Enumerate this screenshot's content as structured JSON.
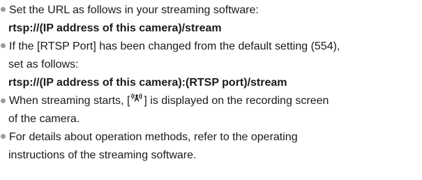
{
  "items": [
    {
      "text": "Set the URL as follows in your streaming software:",
      "url": "rtsp://(IP address of this camera)/stream"
    },
    {
      "text_line1": "If the [RTSP Port] has been changed from the default setting (554),",
      "text_line2": "set as follows:",
      "url": "rtsp://(IP address of this camera):(RTSP port)/stream"
    },
    {
      "text_before_icon": "When streaming starts, [",
      "icon": "streaming-broadcast-icon",
      "text_after_icon": "] is displayed on the recording screen",
      "text_line2": "of the camera."
    },
    {
      "text_line1": "For details about operation methods, refer to the operating",
      "text_line2": "instructions of the streaming software."
    }
  ]
}
